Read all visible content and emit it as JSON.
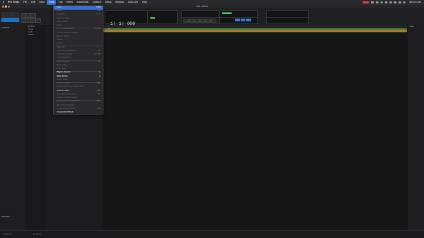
{
  "menubar": {
    "apple_icon": "apple-icon",
    "app_name": "Pro Tools",
    "items": [
      {
        "label": "File",
        "active": false
      },
      {
        "label": "Edit",
        "active": false
      },
      {
        "label": "View",
        "active": false
      },
      {
        "label": "Track",
        "active": true
      },
      {
        "label": "Clip",
        "active": false
      },
      {
        "label": "Event",
        "active": false
      },
      {
        "label": "AudioSuite",
        "active": false
      },
      {
        "label": "Options",
        "active": false
      },
      {
        "label": "Setup",
        "active": false
      },
      {
        "label": "Window",
        "active": false
      },
      {
        "label": "Avid Link",
        "active": false
      },
      {
        "label": "Help",
        "active": false
      }
    ],
    "clock": "Mon 23 Jan",
    "record_color": "#e0454a"
  },
  "window": {
    "title": "Edit: untitled"
  },
  "transport": {
    "counter": "1| 1| 000"
  },
  "sidebar": {
    "tracks_label": "TRACKS",
    "groups_label": "GROUPS"
  },
  "tracklist": {
    "header": "Workflow",
    "items": [
      "Inputs",
      "Audio",
      "Master"
    ]
  },
  "edit": {
    "marker_label": "1|"
  },
  "rightpanel": {
    "label": "Clips"
  },
  "bottom": {
    "left_label": "Edit Window",
    "mid_label": "Mix Window"
  },
  "track_menu": {
    "items": [
      {
        "label": "New...",
        "shortcut": "⇧⌘N",
        "state": "highlight"
      },
      {
        "label": "Group...",
        "shortcut": "⌘G",
        "state": "disabled"
      },
      {
        "label": "Duplicate...",
        "shortcut": "⌥⇧D",
        "state": "disabled"
      },
      {
        "label": "Split into Mono",
        "shortcut": "",
        "state": "disabled"
      },
      {
        "label": "Make Inactive",
        "shortcut": "",
        "state": "disabled"
      },
      {
        "label": "Delete",
        "shortcut": "",
        "state": "sep"
      },
      {
        "label": "Move to New Folder...",
        "shortcut": "⌥⇧⌘N",
        "state": "disabled"
      },
      {
        "label": "Commit Tracks to Playlist...",
        "shortcut": "",
        "state": "disabled"
      },
      {
        "label": "Bounce Tracks...",
        "shortcut": "",
        "state": "disabled"
      },
      {
        "label": "Freeze",
        "shortcut": "",
        "state": "disabled"
      },
      {
        "label": "Create...",
        "shortcut": "",
        "state": "sep"
      },
      {
        "label": "Write Mix",
        "shortcut": "",
        "state": "disabled"
      },
      {
        "label": "Clear All Clip Indicators",
        "shortcut": "⌥C",
        "state": "disabled"
      },
      {
        "label": "Solo Mute Settings",
        "shortcut": "⌥⇧⌘C",
        "state": "disabled"
      },
      {
        "label": "Input Monitoring",
        "shortcut": "",
        "state": "sep"
      },
      {
        "label": "Scroll into View",
        "shortcut": "⌥F",
        "state": "disabled"
      },
      {
        "label": "Record Safe",
        "shortcut": "",
        "state": "disabled"
      },
      {
        "label": "Input Safe",
        "shortcut": "",
        "state": "sep"
      },
      {
        "label": "Bypass Inserts",
        "shortcut": "▶",
        "state": "bold"
      },
      {
        "label": "Mute Sends",
        "shortcut": "▶",
        "state": "bold"
      },
      {
        "label": "Select Tracks",
        "shortcut": "",
        "state": "sep"
      },
      {
        "label": "Scroll to Track...",
        "shortcut": "⌥⌘F",
        "state": "disabled"
      },
      {
        "label": "Set Record Tracks to Input Only",
        "shortcut": "",
        "state": "disabled"
      },
      {
        "label": "Scroll to Track...",
        "shortcut": "⌥⌘F",
        "state": "enabled"
      },
      {
        "label": "Clear All Clip Indicators",
        "shortcut": "⌥C",
        "state": "disabled"
      },
      {
        "label": "Bounce to Track Playlist",
        "shortcut": "",
        "state": "sep"
      },
      {
        "label": "Composite to Target Playlist",
        "shortcut": "⌥⌘V",
        "state": "disabled"
      },
      {
        "label": "Show Target Playlist",
        "shortcut": "",
        "state": "disabled"
      },
      {
        "label": "Toggle Record Playlist",
        "shortcut": "⌥⌘",
        "state": "disabled"
      },
      {
        "label": "Create Click Track",
        "shortcut": "",
        "state": "bold"
      }
    ]
  }
}
